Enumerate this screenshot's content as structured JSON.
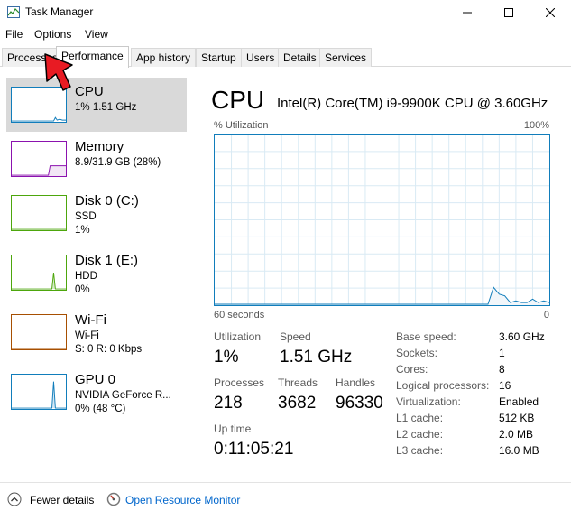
{
  "window": {
    "title": "Task Manager"
  },
  "menu": [
    "File",
    "Options",
    "View"
  ],
  "tabs": [
    "Processes",
    "Performance",
    "App history",
    "Startup",
    "Users",
    "Details",
    "Services"
  ],
  "active_tab": "Performance",
  "resources": [
    {
      "name": "CPU",
      "line1": "1% 1.51 GHz",
      "line2": "",
      "color": "#117dbb",
      "selected": true
    },
    {
      "name": "Memory",
      "line1": "8.9/31.9 GB (28%)",
      "line2": "",
      "color": "#8b12ae",
      "selected": false
    },
    {
      "name": "Disk 0 (C:)",
      "line1": "SSD",
      "line2": "1%",
      "color": "#4da60c",
      "selected": false
    },
    {
      "name": "Disk 1 (E:)",
      "line1": "HDD",
      "line2": "0%",
      "color": "#4da60c",
      "selected": false
    },
    {
      "name": "Wi-Fi",
      "line1": "Wi-Fi",
      "line2": "S: 0 R: 0 Kbps",
      "color": "#a74f01",
      "selected": false
    },
    {
      "name": "GPU 0",
      "line1": "NVIDIA GeForce R...",
      "line2": "0% (48 °C)",
      "color": "#117dbb",
      "selected": false
    }
  ],
  "cpu": {
    "title": "CPU",
    "model": "Intel(R) Core(TM) i9-9900K CPU @ 3.60GHz",
    "graph_label": "% Utilization",
    "graph_max": "100%",
    "graph_time": "60 seconds",
    "graph_min": "0",
    "utilization_label": "Utilization",
    "utilization": "1%",
    "speed_label": "Speed",
    "speed": "1.51 GHz",
    "processes_label": "Processes",
    "processes": "218",
    "threads_label": "Threads",
    "threads": "3682",
    "handles_label": "Handles",
    "handles": "96330",
    "uptime_label": "Up time",
    "uptime": "0:11:05:21",
    "specs": [
      {
        "label": "Base speed:",
        "value": "3.60 GHz"
      },
      {
        "label": "Sockets:",
        "value": "1"
      },
      {
        "label": "Cores:",
        "value": "8"
      },
      {
        "label": "Logical processors:",
        "value": "16"
      },
      {
        "label": "Virtualization:",
        "value": "Enabled"
      },
      {
        "label": "L1 cache:",
        "value": "512 KB"
      },
      {
        "label": "L2 cache:",
        "value": "2.0 MB"
      },
      {
        "label": "L3 cache:",
        "value": "16.0 MB"
      }
    ],
    "history": [
      0,
      0,
      0,
      0,
      0,
      0,
      0,
      0,
      0,
      0,
      0,
      0,
      0,
      0,
      0,
      0,
      0,
      0,
      0,
      0,
      0,
      0,
      0,
      0,
      0,
      0,
      0,
      0,
      0,
      0,
      0,
      0,
      0,
      0,
      0,
      0,
      0,
      0,
      0,
      0,
      0,
      0,
      0,
      0,
      0,
      0,
      0,
      0,
      0,
      0,
      10,
      6,
      5,
      1,
      2,
      1,
      1,
      3,
      1,
      2,
      1
    ]
  },
  "footer": {
    "fewer_details": "Fewer details",
    "open_monitor": "Open Resource Monitor"
  }
}
